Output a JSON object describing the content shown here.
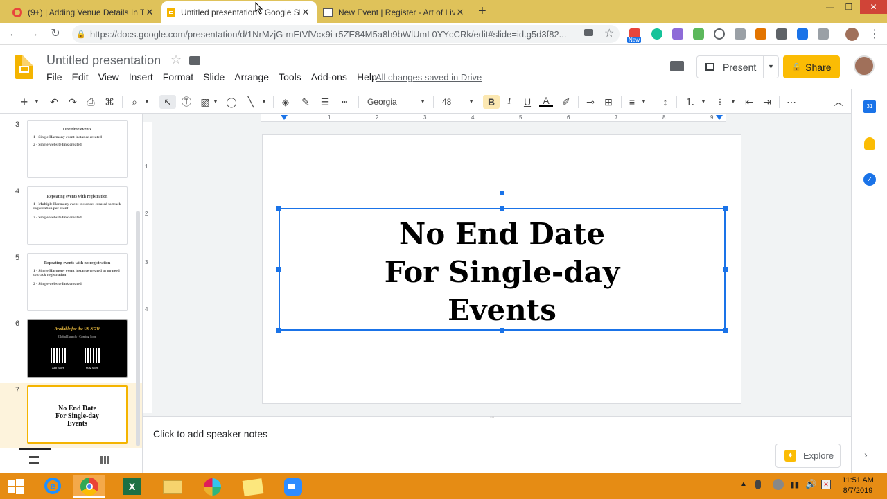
{
  "tabs": [
    {
      "title": "(9+) | Adding Venue Details In Th",
      "icon": "chrome-favicon-icon"
    },
    {
      "title": "Untitled presentation - Google Sl",
      "icon": "slides-favicon-icon"
    },
    {
      "title": "New Event | Register - Art of Livi",
      "icon": "aol-favicon-icon"
    }
  ],
  "close_glyph": "✕",
  "new_tab_glyph": "+",
  "address": {
    "url": "https://docs.google.com/presentation/d/1NrMzjG-mEtVfVcx9i-r5ZE84M5a8h9bWlUmL0YYcCRk/edit#slide=id.g5d3f82..."
  },
  "ext_badge": "New",
  "doc": {
    "title": "Untitled presentation",
    "menus": [
      "File",
      "Edit",
      "View",
      "Insert",
      "Format",
      "Slide",
      "Arrange",
      "Tools",
      "Add-ons",
      "Help"
    ],
    "saved_status": "All changes saved in Drive",
    "present_label": "Present",
    "share_label": "Share"
  },
  "format": {
    "font": "Georgia",
    "size": "48"
  },
  "ruler": {
    "h_ticks": [
      "1",
      "2",
      "3",
      "4",
      "5",
      "6",
      "7",
      "8",
      "9"
    ],
    "v_ticks": [
      "1",
      "2",
      "3",
      "4"
    ]
  },
  "filmstrip": [
    {
      "num": "3",
      "title": "One time events",
      "lines": [
        "1 - Single Harmony event instance created",
        "2 - Single website link created"
      ]
    },
    {
      "num": "4",
      "title": "Repeating events with registration",
      "lines": [
        "1 - Multiple Harmony event instances created to track registration per event.",
        "2 - Single website link created"
      ]
    },
    {
      "num": "5",
      "title": "Repeating events with no registration",
      "lines": [
        "1 - Single Harmony event instance created as no need to track registration",
        "2 - Single website link created"
      ]
    },
    {
      "num": "6",
      "title": "Available for the US NOW",
      "subtitle": "Global Launch - Coming Soon",
      "badges": [
        "App Store",
        "Play Store"
      ]
    },
    {
      "num": "7",
      "title_lines": [
        "No End Date",
        "For Single-day",
        "Events"
      ]
    }
  ],
  "slide": {
    "lines": [
      "No End Date",
      "For Single-day",
      "Events"
    ]
  },
  "notes_placeholder": "Click to add speaker notes",
  "explore_label": "Explore",
  "side_panel": {
    "calendar_label": "31"
  },
  "taskbar": {
    "time": "11:51 AM",
    "date": "8/7/2019"
  },
  "colors": {
    "accent": "#fbbc04",
    "selection": "#1a73e8",
    "tabstrip": "#dfc25a",
    "taskbar": "#e68c14"
  }
}
